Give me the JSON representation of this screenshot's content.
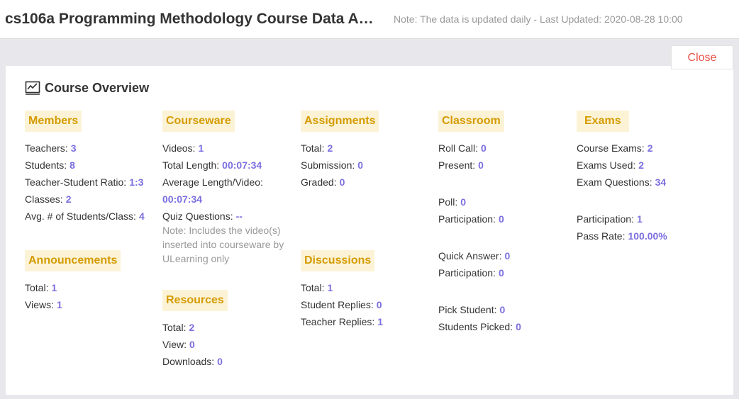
{
  "header": {
    "title": "cs106a Programming Methodology Course Data An...",
    "note": "Note: The data is updated daily - Last Updated: 2020-08-28 10:00"
  },
  "close_label": "Close",
  "overview": {
    "title": "Course Overview",
    "icon": "chart-line-icon"
  },
  "members": {
    "label": "Members",
    "teachers_label": "Teachers:",
    "teachers": "3",
    "students_label": "Students:",
    "students": "8",
    "ratio_label": "Teacher-Student Ratio:",
    "ratio": "1:3",
    "classes_label": "Classes:",
    "classes": "2",
    "avg_label": "Avg. # of Students/Class:",
    "avg": "4"
  },
  "announcements": {
    "label": "Announcements",
    "total_label": "Total:",
    "total": "1",
    "views_label": "Views:",
    "views": "1"
  },
  "courseware": {
    "label": "Courseware",
    "videos_label": "Videos:",
    "videos": "1",
    "total_length_label": "Total Length:",
    "total_length": "00:07:34",
    "avg_length_label": "Average Length/Video:",
    "avg_length": "00:07:34",
    "quiz_label": "Quiz Questions:",
    "quiz": "--",
    "note": "Note: Includes the video(s) inserted into courseware by ULearning only"
  },
  "resources": {
    "label": "Resources",
    "total_label": "Total:",
    "total": "2",
    "view_label": "View:",
    "view": "0",
    "downloads_label": "Downloads:",
    "downloads": "0"
  },
  "assignments": {
    "label": "Assignments",
    "total_label": "Total:",
    "total": "2",
    "submission_label": "Submission:",
    "submission": "0",
    "graded_label": "Graded:",
    "graded": "0"
  },
  "discussions": {
    "label": "Discussions",
    "total_label": "Total:",
    "total": "1",
    "student_replies_label": "Student Replies:",
    "student_replies": "0",
    "teacher_replies_label": "Teacher Replies:",
    "teacher_replies": "1"
  },
  "classroom": {
    "label": "Classroom",
    "roll_call_label": "Roll Call:",
    "roll_call": "0",
    "present_label": "Present:",
    "present": "0",
    "poll_label": "Poll:",
    "poll": "0",
    "poll_participation_label": "Participation:",
    "poll_participation": "0",
    "quick_answer_label": "Quick Answer:",
    "quick_answer": "0",
    "qa_participation_label": "Participation:",
    "qa_participation": "0",
    "pick_student_label": "Pick Student:",
    "pick_student": "0",
    "students_picked_label": "Students Picked:",
    "students_picked": "0"
  },
  "exams": {
    "label": "Exams",
    "course_exams_label": "Course Exams:",
    "course_exams": "2",
    "exams_used_label": "Exams Used:",
    "exams_used": "2",
    "exam_questions_label": "Exam Questions:",
    "exam_questions": "34",
    "participation_label": "Participation:",
    "participation": "1",
    "pass_rate_label": "Pass Rate:",
    "pass_rate": "100.00%"
  }
}
